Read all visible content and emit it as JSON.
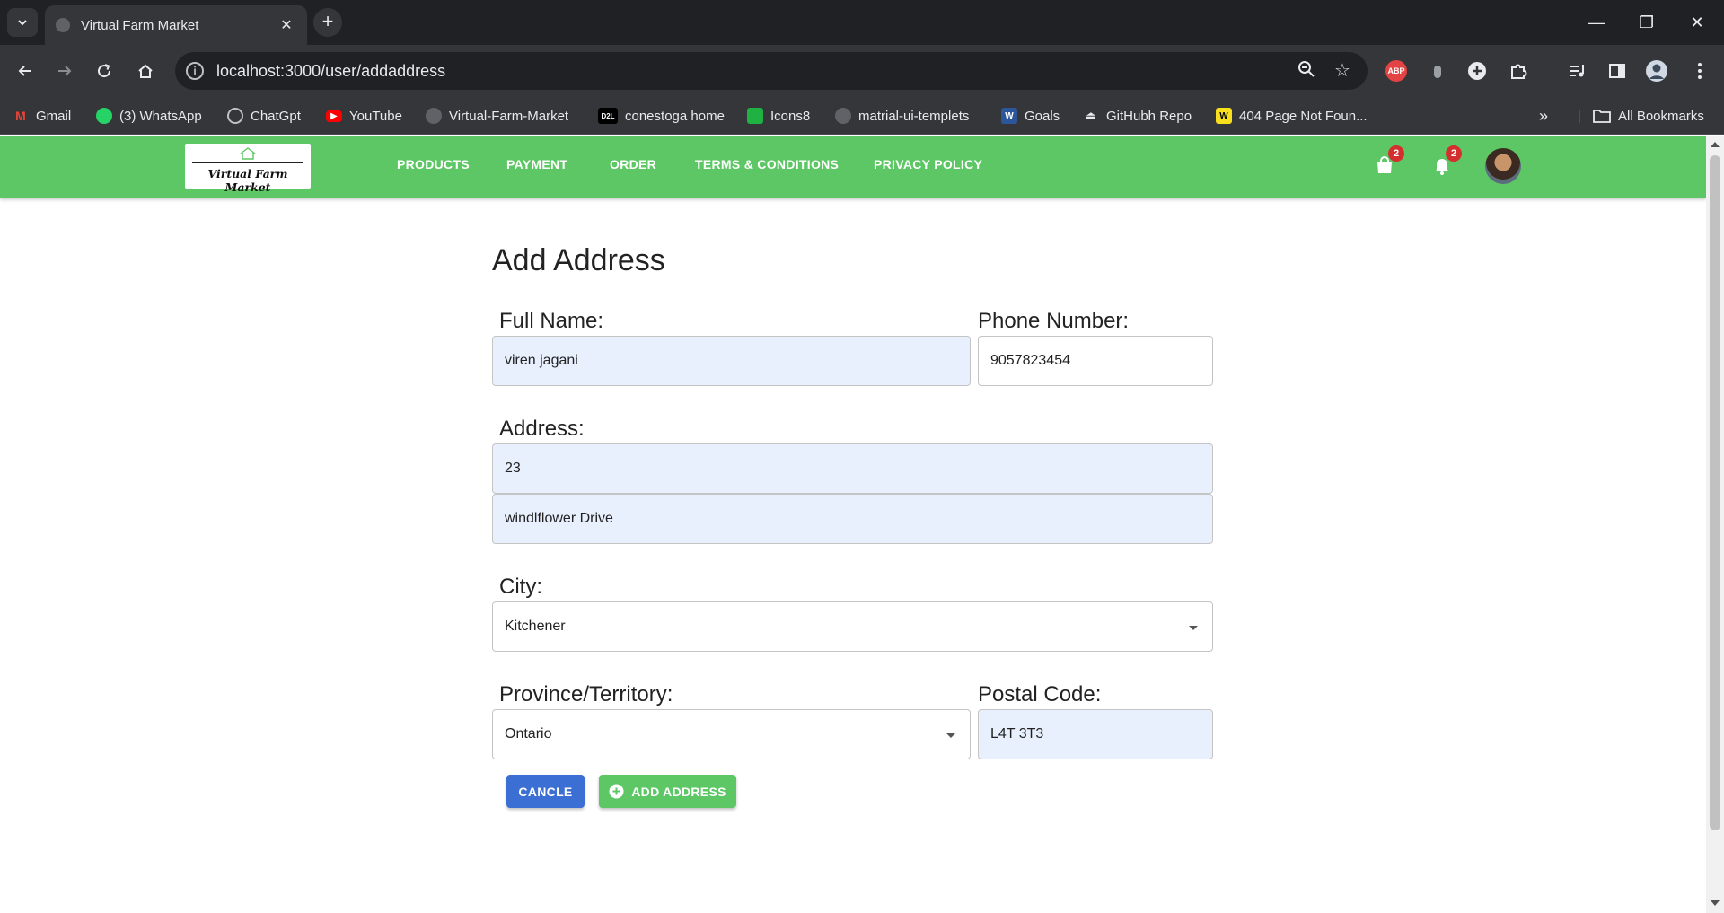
{
  "browser": {
    "tab_title": "Virtual Farm Market",
    "url": "localhost:3000/user/addaddress",
    "bookmarks": [
      {
        "label": "Gmail",
        "icon": "gmail-icon",
        "color": "#ea4335"
      },
      {
        "label": "(3) WhatsApp",
        "icon": "whatsapp-icon",
        "color": "#25d366"
      },
      {
        "label": "ChatGpt",
        "icon": "chatgpt-icon",
        "color": "#8e8e8e"
      },
      {
        "label": "YouTube",
        "icon": "youtube-icon",
        "color": "#ff0000"
      },
      {
        "label": "Virtual-Farm-Market",
        "icon": "github-icon",
        "color": "#24292e"
      },
      {
        "label": "conestoga home",
        "icon": "d2l-icon",
        "color": "#000000"
      },
      {
        "label": "Icons8",
        "icon": "icons8-icon",
        "color": "#1fb141"
      },
      {
        "label": "matrial-ui-templets",
        "icon": "github-icon",
        "color": "#24292e"
      },
      {
        "label": "Goals",
        "icon": "word-icon",
        "color": "#2b579a"
      },
      {
        "label": "GitHubh Repo",
        "icon": "person-icon",
        "color": "#e8eaed"
      },
      {
        "label": "404 Page Not Foun...",
        "icon": "w-icon",
        "color": "#f7df1e"
      }
    ],
    "all_bookmarks": "All Bookmarks"
  },
  "app": {
    "logo_text": "Virtual Farm Market",
    "nav": [
      "PRODUCTS",
      "PAYMENT",
      "ORDER",
      "TERMS & CONDITIONS",
      "PRIVACY POLICY"
    ],
    "cart_count": "2",
    "notification_count": "2",
    "brand_color": "#5cc764"
  },
  "form": {
    "title": "Add Address",
    "full_name_label": "Full Name:",
    "full_name_value": "viren jagani",
    "phone_label": "Phone Number:",
    "phone_value": "9057823454",
    "address_label": "Address:",
    "address_line1": "23",
    "address_line2": "windlflower Drive",
    "city_label": "City:",
    "city_value": "Kitchener",
    "province_label": "Province/Territory:",
    "province_value": "Ontario",
    "postal_label": "Postal Code:",
    "postal_value": "L4T 3T3",
    "cancel_label": "CANCLE",
    "add_label": "ADD ADDRESS",
    "cancel_color": "#3b6fd4",
    "add_color": "#5cc764"
  }
}
